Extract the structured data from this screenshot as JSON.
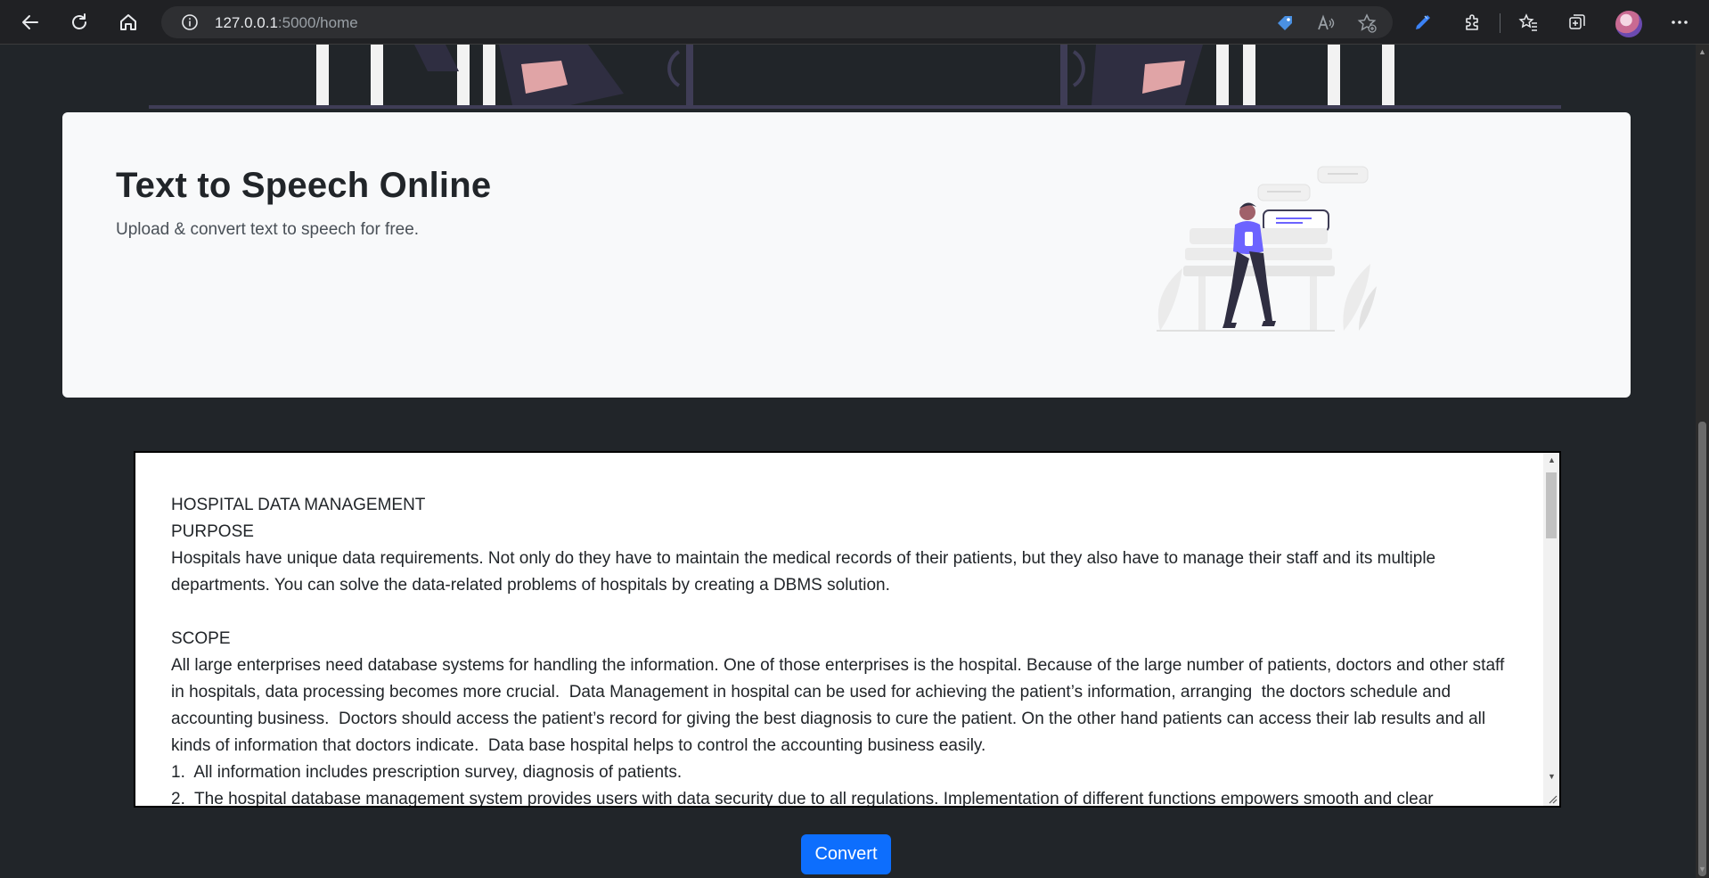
{
  "browser": {
    "url_host": "127.0.0.1",
    "url_path": ":5000/home"
  },
  "header": {
    "title": "Text to Speech Online",
    "subtitle": "Upload & convert text to speech for free."
  },
  "editor": {
    "content": "HOSPITAL DATA MANAGEMENT\nPURPOSE\nHospitals have unique data requirements. Not only do they have to maintain the medical records of their patients, but they also have to manage their staff and its multiple departments. You can solve the data-related problems of hospitals by creating a DBMS solution.\n\nSCOPE\nAll large enterprises need database systems for handling the information. One of those enterprises is the hospital. Because of the large number of patients, doctors and other staff in hospitals, data processing becomes more crucial.  Data Management in hospital can be used for achieving the patient’s information, arranging  the doctors schedule and  accounting business.  Doctors should access the patient’s record for giving the best diagnosis to cure the patient. On the other hand patients can access their lab results and all kinds of information that doctors indicate.  Data base hospital helps to control the accounting business easily.\n1.  All information includes prescription survey, diagnosis of patients.\n2.  The hospital database management system provides users with data security due to all regulations. Implementation of different functions empowers smooth and clear"
  },
  "actions": {
    "convert_label": "Convert"
  }
}
